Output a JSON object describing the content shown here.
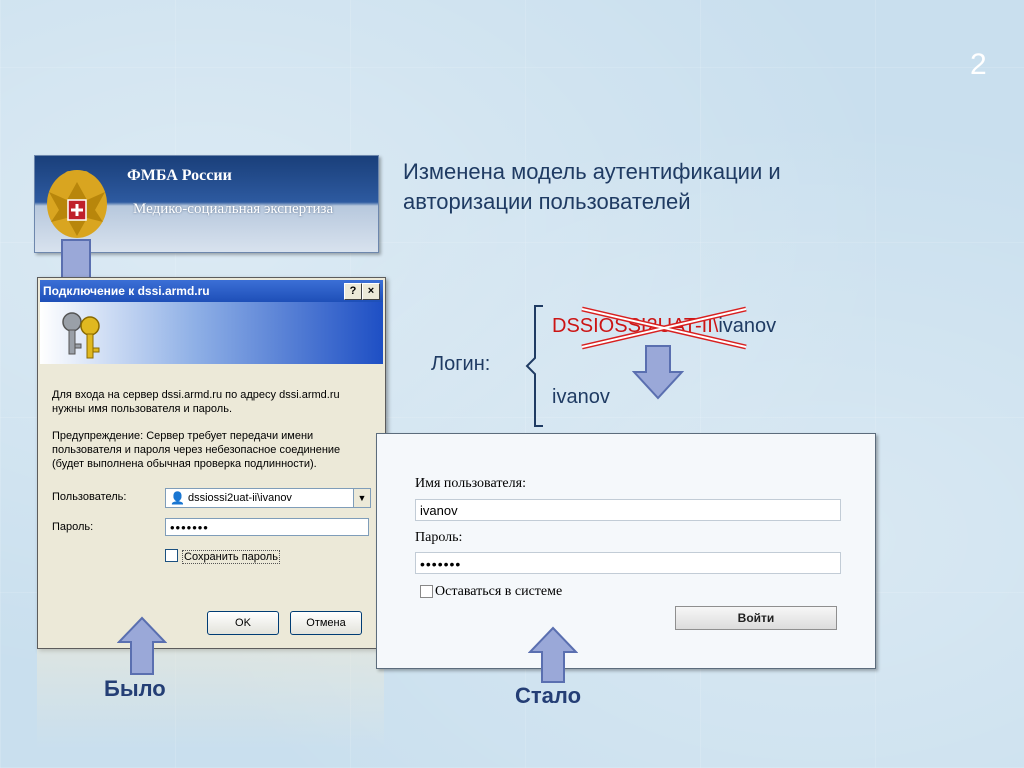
{
  "slide": {
    "number": "2"
  },
  "banner": {
    "title": "ФМБА России",
    "subtitle": "Медико-социальная экспертиза",
    "emblem_icon": "eagle-emblem-icon"
  },
  "old_dialog": {
    "title": "Подключение к dssi.armd.ru",
    "help_label": "?",
    "close_label": "×",
    "intro_text_1": "Для входа на сервер dssi.armd.ru по адресу dssi.armd.ru",
    "intro_text_2": "нужны имя пользователя и пароль.",
    "warning_1": "Предупреждение: Сервер требует передачи имени",
    "warning_2": "пользователя и пароля через небезопасное соединение",
    "warning_3": "(будет выполнена обычная проверка подлинности).",
    "user_label": "Пользователь:",
    "user_value": "dssiossi2uat-ii\\ivanov",
    "password_label": "Пароль:",
    "password_value": "•••••••",
    "remember_label": "Сохранить пароль",
    "ok_label": "OK",
    "cancel_label": "Отмена"
  },
  "heading": "Изменена модель аутентификации и авторизации пользователей",
  "login": {
    "label": "Логин:",
    "old_prefix": "DSSIOSSI2UAT-II\\",
    "old_user": "ivanov",
    "new_value": "ivanov"
  },
  "new_form": {
    "username_label": "Имя пользователя:",
    "username_value": "ivanov",
    "password_label": "Пароль:",
    "password_value": "•••••••",
    "stay_label": "Оставаться в системе",
    "submit_label": "Войти"
  },
  "captions": {
    "before": "Было",
    "after": "Стало"
  },
  "colors": {
    "arrow_fill": "#9aa8d8",
    "arrow_stroke": "#5a6fb0",
    "cross": "#d82020",
    "text": "#1f3b63"
  }
}
